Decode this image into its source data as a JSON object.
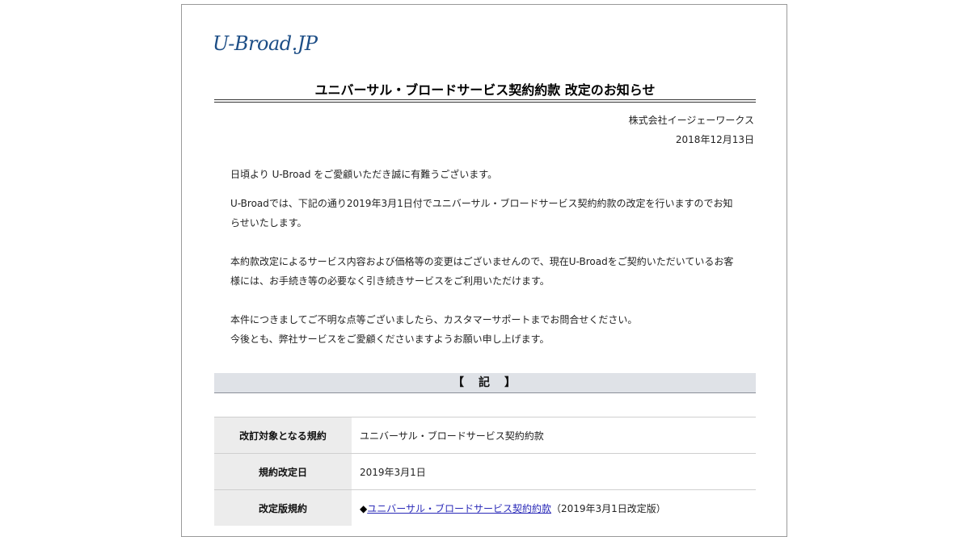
{
  "header": {
    "logo": "U-Broad.JP",
    "title": "ユニバーサル・ブロードサービス契約約款 改定のお知らせ",
    "company": "株式会社イージェーワークス",
    "date": "2018年12月13日"
  },
  "body": {
    "p1": "日頃より U-Broad をご愛顧いただき誠に有難うございます。",
    "p2": "U-Broadでは、下記の通り2019年3月1日付でユニバーサル・ブロードサービス契約約款の改定を行いますのでお知らせいたします。",
    "p3": "本約款改定によるサービス内容および価格等の変更はございませんので、現在U-Broadをご契約いただいているお客様には、お手続き等の必要なく引き続きサービスをご利用いただけます。",
    "p4_line1": "本件につきましてご不明な点等ございましたら、カスタマーサポートまでお問合せください。",
    "p4_line2": "今後とも、弊社サービスをご愛顧くださいますようお願い申し上げます。"
  },
  "ki": {
    "label": "【　記　】"
  },
  "table": {
    "rows": [
      {
        "label": "改訂対象となる規約",
        "value": "ユニバーサル・ブロードサービス契約約款"
      },
      {
        "label": "規約改定日",
        "value": "2019年3月1日"
      },
      {
        "label": "改定版規約",
        "bullet": "◆",
        "link": "ユニバーサル・ブロードサービス契約約款",
        "suffix": "（2019年3月1日改定版）"
      }
    ]
  }
}
